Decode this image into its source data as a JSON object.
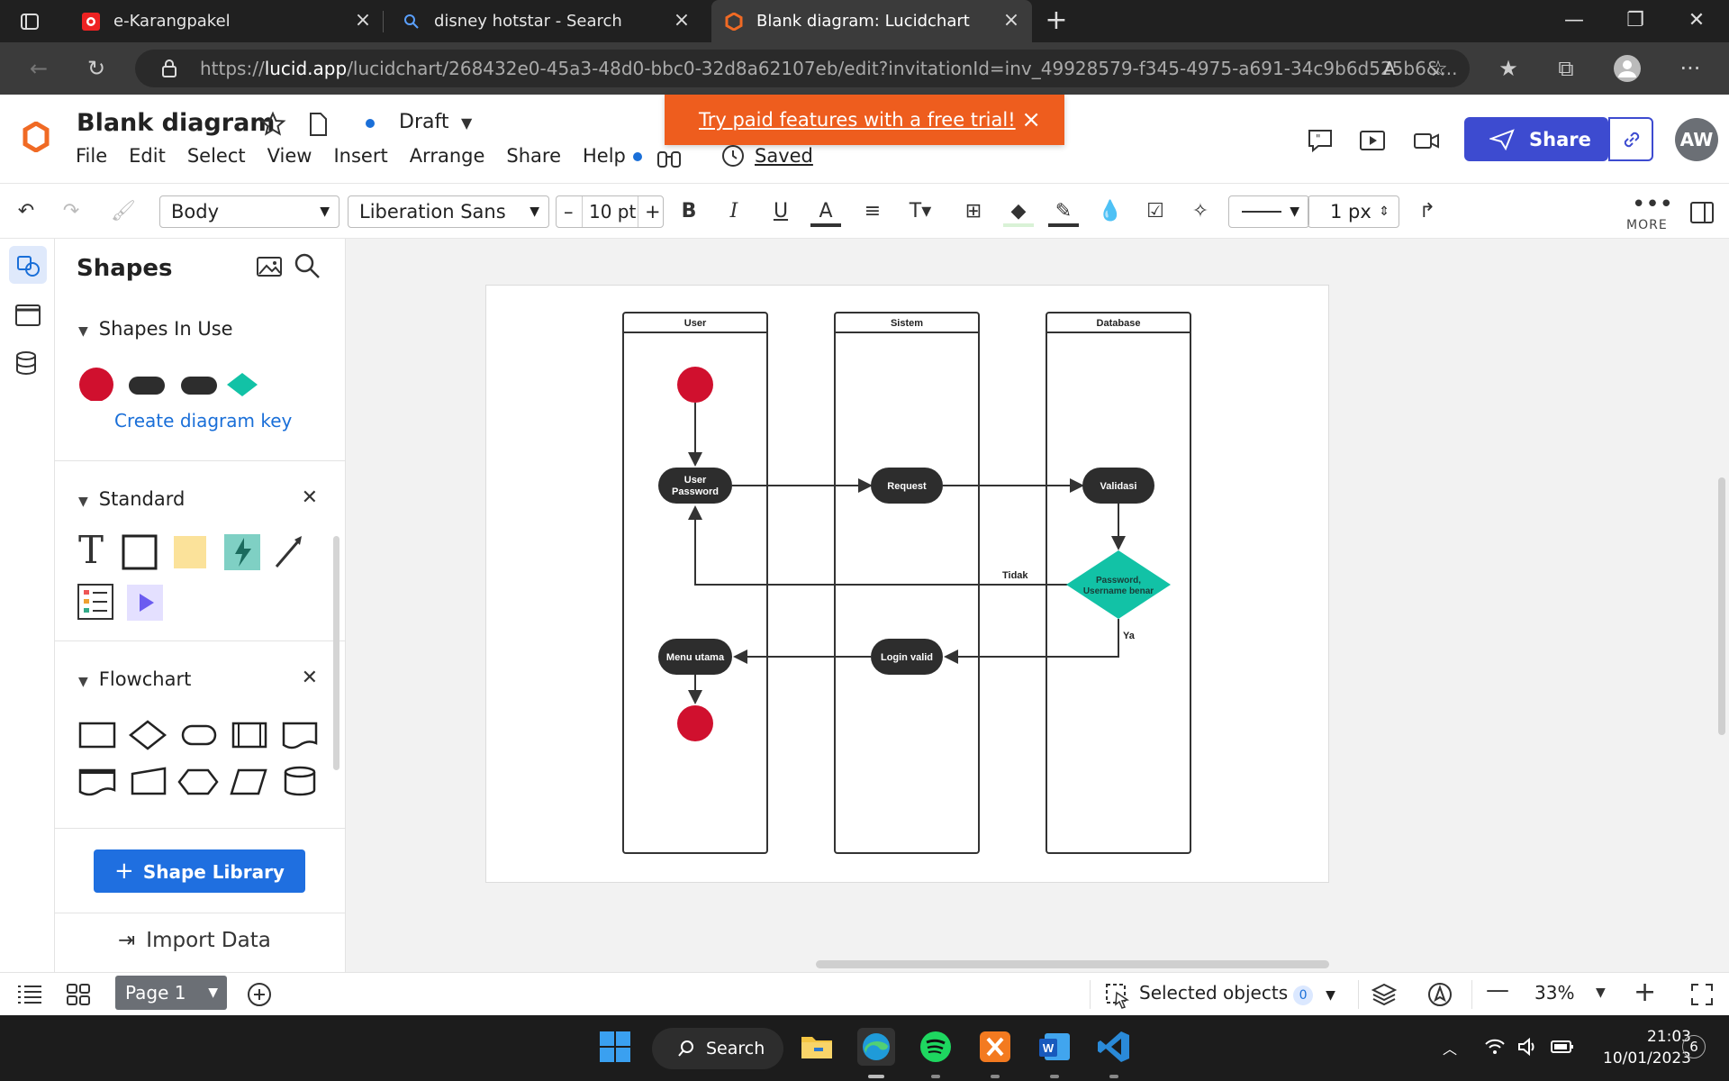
{
  "browser": {
    "tabs": [
      {
        "title": "e-Karangpakel"
      },
      {
        "title": "disney hotstar - Search"
      },
      {
        "title": "Blank diagram: Lucidchart"
      }
    ],
    "url_host": "lucid.app",
    "url_prefix": "https://",
    "url_path": "/lucidchart/268432e0-45a3-48d0-bbc0-32d8a62107eb/edit?invitationId=inv_49928579-f345-4975-a691-34c9b6d525b6&..."
  },
  "header": {
    "title": "Blank diagram",
    "status": "Draft",
    "menu": [
      "File",
      "Edit",
      "Select",
      "View",
      "Insert",
      "Arrange",
      "Share",
      "Help"
    ],
    "saved": "Saved",
    "trial_banner": "Try paid features with a free trial!",
    "share_label": "Share",
    "avatar_initials": "AW",
    "accent_color": "#3d4bd0"
  },
  "toolbar": {
    "text_style": "Body",
    "font": "Liberation Sans",
    "font_size": "10 pt",
    "line_width": "1 px",
    "more_label": "MORE"
  },
  "panel": {
    "title": "Shapes",
    "shapes_in_use": "Shapes In Use",
    "create_key": "Create diagram key",
    "standard": "Standard",
    "flowchart": "Flowchart",
    "shape_library": "Shape Library",
    "import_data": "Import Data"
  },
  "diagram": {
    "lanes": [
      "User",
      "Sistem",
      "Database"
    ],
    "nodes": {
      "user_password": [
        "User",
        "Password"
      ],
      "request": "Request",
      "validasi": "Validasi",
      "decision": [
        "Password,",
        "Username benar"
      ],
      "login_valid": "Login valid",
      "menu_utama": "Menu utama"
    },
    "edge_labels": {
      "no": "Tidak",
      "yes": "Ya"
    },
    "colors": {
      "start_end": "#d0102e",
      "process": "#2d2d2d",
      "decision": "#12c2a6"
    }
  },
  "bottom": {
    "page_label": "Page 1",
    "selected_objects": "Selected objects",
    "selected_count": "0",
    "zoom": "33%"
  },
  "taskbar": {
    "search": "Search",
    "time": "21:03",
    "date": "10/01/2023",
    "notifications": "6"
  }
}
